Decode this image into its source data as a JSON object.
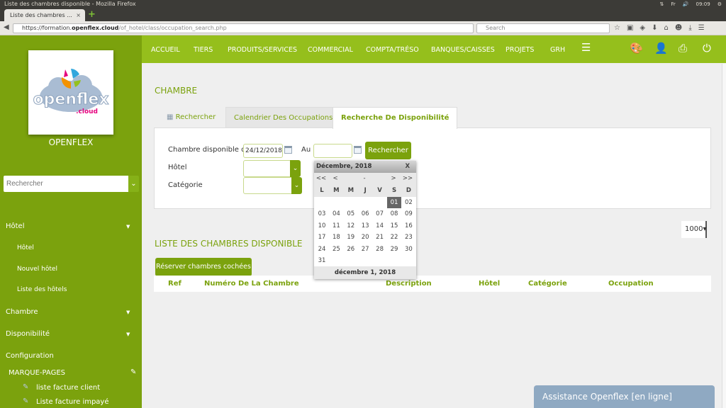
{
  "os": {
    "window_title": "Liste des chambres disponible - Mozilla Firefox",
    "tray": [
      "⇅",
      "Fr",
      "🔊",
      "09:09",
      "⚙"
    ]
  },
  "browser": {
    "tab_title": "Liste des chambres ...",
    "url_prefix": "https://formation.",
    "url_domain": "openflex.cloud",
    "url_path": "/of_hotel/class/occupation_search.php",
    "search_placeholder": "Search"
  },
  "sidebar": {
    "brand": "OPENFLEX",
    "logo_text": "openflex.cloud",
    "search_placeholder": "Rechercher",
    "items": [
      {
        "label": "Hôtel"
      },
      {
        "label": "Hôtel"
      },
      {
        "label": "Nouvel hôtel"
      },
      {
        "label": "Liste des hôtels"
      },
      {
        "label": "Chambre"
      },
      {
        "label": "Disponibilité"
      },
      {
        "label": "Configuration"
      },
      {
        "label": "MARQUE-PAGES"
      },
      {
        "label": "liste facture client"
      },
      {
        "label": "Liste facture impayé"
      }
    ]
  },
  "topnav": {
    "items": [
      "ACCUEIL",
      "TIERS",
      "PRODUITS/SERVICES",
      "COMMERCIAL",
      "COMPTA/TRÉSO",
      "BANQUES/CAISSES",
      "PROJETS",
      "GRH"
    ]
  },
  "main": {
    "title": "CHAMBRE",
    "tabs": [
      "Rechercher",
      "Calendrier Des Occupations",
      "Recherche De Disponibilité"
    ],
    "form": {
      "from_label": "Chambre disponible du :",
      "from_value": "24/12/2018",
      "to_label": "Au :",
      "to_value": "",
      "search_button": "Rechercher",
      "hotel_label": "Hôtel",
      "category_label": "Catégorie"
    },
    "list_title": "LISTE DES CHAMBRES DISPONIBLE",
    "reserve_button": "Réserver chambres cochées",
    "page_size": "1000",
    "columns": [
      "Ref",
      "Numéro De La Chambre",
      "Description",
      "Hôtel",
      "Catégorie",
      "Occupation"
    ]
  },
  "calendar": {
    "title": "Décembre, 2018",
    "close": "X",
    "nav": [
      "<<",
      "<",
      "-",
      ">",
      ">>"
    ],
    "weekdays": [
      "L",
      "M",
      "M",
      "J",
      "V",
      "S",
      "D"
    ],
    "weeks": [
      [
        "",
        "",
        "",
        "",
        "",
        "01",
        "02"
      ],
      [
        "03",
        "04",
        "05",
        "06",
        "07",
        "08",
        "09"
      ],
      [
        "10",
        "11",
        "12",
        "13",
        "14",
        "15",
        "16"
      ],
      [
        "17",
        "18",
        "19",
        "20",
        "21",
        "22",
        "23"
      ],
      [
        "24",
        "25",
        "26",
        "27",
        "28",
        "29",
        "30"
      ],
      [
        "31",
        "",
        "",
        "",
        "",
        "",
        ""
      ]
    ],
    "selected": "01",
    "footer": "décembre 1, 2018"
  },
  "assist": "Assistance Openflex [en ligne]",
  "colors": {
    "sidebar": "#7ba20d",
    "topnav": "#95bf1c",
    "accent": "#7ba20d"
  }
}
